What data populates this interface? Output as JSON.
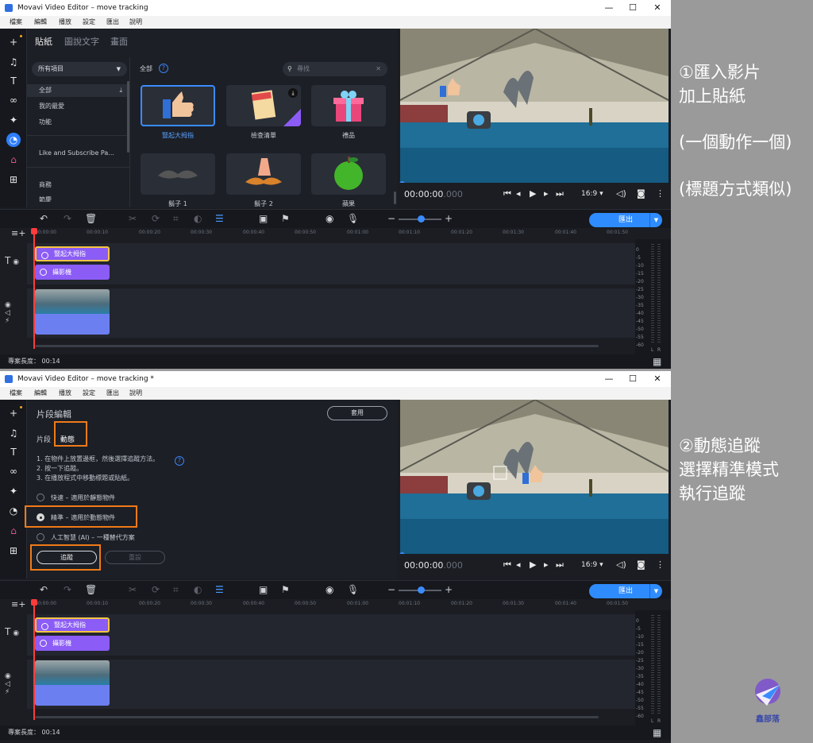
{
  "window1": {
    "title": "Movavi Video Editor – move tracking",
    "menu": [
      "檔案",
      "編輯",
      "播放",
      "設定",
      "匯出",
      "說明"
    ],
    "panel_tabs": [
      "貼紙",
      "圖說文字",
      "畫面"
    ],
    "category_select": "所有項目",
    "categories": [
      "全部",
      "我的最愛",
      "功能",
      "Like and Subscribe Pa...",
      "商務",
      "節慶"
    ],
    "section_title": "全部",
    "search_placeholder": "尋找",
    "stickers": [
      "豎起大拇指",
      "檢查清單",
      "禮品",
      "鬍子 1",
      "鬍子 2",
      "蘋果"
    ],
    "timecode_main": "00:00:00",
    "timecode_ms": ".000",
    "aspect": "16:9",
    "export_label": "匯出",
    "ruler": [
      "00:00:00",
      "00:00:10",
      "00:00:20",
      "00:00:30",
      "00:00:40",
      "00:00:50",
      "00:01:00",
      "00:01:10",
      "00:01:20",
      "00:01:30",
      "00:01:40",
      "00:01:50"
    ],
    "clips": [
      "豎起大拇指",
      "攝影機"
    ],
    "meter_labels": [
      "0",
      "-5",
      "-10",
      "-15",
      "-20",
      "-25",
      "-30",
      "-35",
      "-40",
      "-45",
      "-50",
      "-55",
      "-60"
    ],
    "meter_lr": [
      "L",
      "R"
    ],
    "status": "專案長度：  00:14"
  },
  "window2": {
    "title": "Movavi Video Editor – move tracking *",
    "menu": [
      "檔案",
      "編輯",
      "播放",
      "設定",
      "匯出",
      "說明"
    ],
    "panel_title": "片段編輯",
    "apply_label": "套用",
    "tabs": [
      "片段",
      "動態"
    ],
    "instructions": [
      "1. 在物件上放置邊框，然後選擇追蹤方法。",
      "2. 按一下追蹤。",
      "3. 在播放程式中移動標題或貼紙。"
    ],
    "options": [
      {
        "label": "快速 – 適用於靜態物件",
        "selected": false
      },
      {
        "label": "精準 – 適用於動態物件",
        "selected": true
      },
      {
        "label": "人工智慧 (AI) – 一種替代方案",
        "selected": false
      }
    ],
    "track_button": "追蹤",
    "cancel_button": "重設",
    "timecode_main": "00:00:00",
    "timecode_ms": ".000",
    "aspect": "16:9",
    "export_label": "匯出",
    "ruler": [
      "00:00:00",
      "00:00:10",
      "00:00:20",
      "00:00:30",
      "00:00:40",
      "00:00:50",
      "00:01:00",
      "00:01:10",
      "00:01:20",
      "00:01:30",
      "00:01:40",
      "00:01:50"
    ],
    "clips": [
      "豎起大拇指",
      "攝影機"
    ],
    "meter_labels": [
      "0",
      "-5",
      "-10",
      "-15",
      "-20",
      "-25",
      "-30",
      "-35",
      "-40",
      "-45",
      "-50",
      "-55",
      "-60"
    ],
    "meter_lr": [
      "L",
      "R"
    ],
    "status": "專案長度：  00:14"
  },
  "annotations": {
    "a1": "①匯入影片\n加上貼紙",
    "a2": "(一個動作一個)",
    "a3": "(標題方式類似)",
    "a4": "②動態追蹤\n選擇精準模式\n執行追蹤"
  },
  "logo_text": "鑫部落",
  "colors": {
    "accent": "#2f8cff",
    "clip": "#8b5cf6",
    "highlight": "#f07a18",
    "background": "#1b1d23"
  }
}
